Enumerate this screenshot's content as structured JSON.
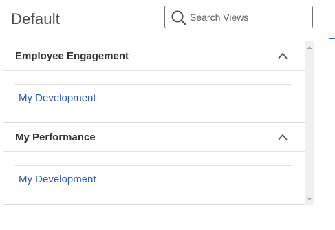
{
  "page": {
    "title": "Default"
  },
  "search": {
    "placeholder": "Search Views",
    "value": ""
  },
  "sections": [
    {
      "title": "Employee Engagement",
      "expanded": true,
      "items": [
        {
          "label": "My Development"
        }
      ]
    },
    {
      "title": "My Performance",
      "expanded": true,
      "items": [
        {
          "label": "My Development"
        }
      ]
    }
  ],
  "colors": {
    "link": "#2a58b5",
    "accent": "#1f6fd1",
    "heading": "#333333"
  }
}
